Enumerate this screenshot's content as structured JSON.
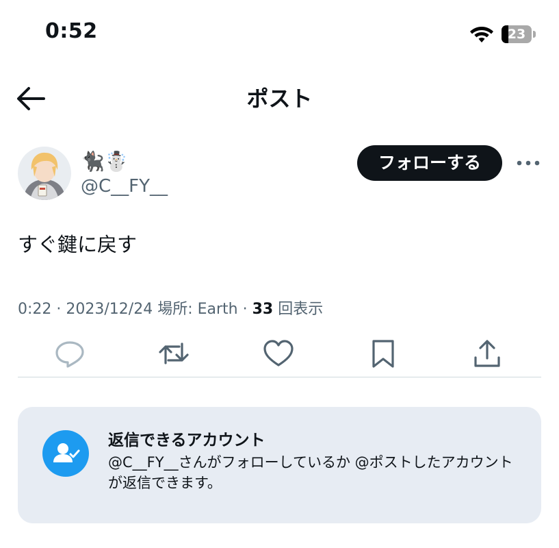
{
  "status_bar": {
    "time": "0:52",
    "battery_level": "23",
    "battery_fraction": 0.23,
    "wifi_icon": "wifi-icon"
  },
  "header": {
    "back_icon": "arrow-left-icon",
    "title": "ポスト"
  },
  "author": {
    "avatar_icon": "avatar-image",
    "display_name": "🐈‍⬛☃️",
    "handle": "@C__FY__",
    "follow_label": "フォローする",
    "more_icon": "more-horizontal-icon"
  },
  "post": {
    "text": "すぐ鍵に戻す",
    "time": "0:22",
    "date": "2023/12/24",
    "location_label": "場所: Earth",
    "views_count": "33",
    "views_label": "回表示"
  },
  "actions": [
    {
      "name": "reply",
      "icon": "reply-icon"
    },
    {
      "name": "repost",
      "icon": "repost-icon"
    },
    {
      "name": "like",
      "icon": "heart-icon"
    },
    {
      "name": "bookmark",
      "icon": "bookmark-icon"
    },
    {
      "name": "share",
      "icon": "share-icon"
    }
  ],
  "reply_notice": {
    "icon": "user-check-icon",
    "title": "返信できるアカウント",
    "body": "@C__FY__さんがフォローしているか @ポストしたアカウントが返信できます。"
  },
  "colors": {
    "text_primary": "#0f1419",
    "text_secondary": "#536471",
    "accent_blue": "#1d9bf0",
    "follow_button_bg": "#0f1419",
    "notice_bg": "#e7ecf3",
    "disabled_icon": "#aab8c2"
  }
}
